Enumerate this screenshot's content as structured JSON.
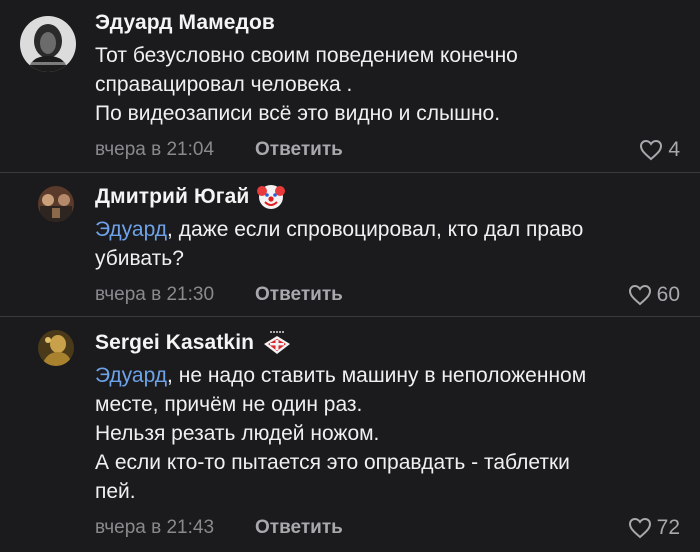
{
  "comments": [
    {
      "author": "Эдуард Мамедов",
      "lines": [
        "Тот безусловно своим поведением конечно",
        "справацировал человека .",
        "По видеозаписи всё это видно и слышно."
      ],
      "mention": "",
      "time": "вчера в 21:04",
      "reply_label": "Ответить",
      "likes": "4",
      "avatar_icon": "portrait-avatar",
      "badge_icon": ""
    },
    {
      "author": "Дмитрий Югай",
      "mention": "Эдуард",
      "lines": [
        ", даже если спровоцировал, кто дал право",
        "убивать?"
      ],
      "time": "вчера в 21:30",
      "reply_label": "Ответить",
      "likes": "60",
      "avatar_icon": "group-photo-avatar",
      "badge_icon": "clown-face-icon"
    },
    {
      "author": "Sergei Kasatkin",
      "mention": "Эдуард",
      "lines": [
        ", не надо ставить машину в неположенном",
        "месте, причём не один раз.",
        "Нельзя резать людей ножом.",
        "А если кто-то пытается это оправдать - таблетки",
        "пей."
      ],
      "time": "вчера в 21:43",
      "reply_label": "Ответить",
      "likes": "72",
      "avatar_icon": "golden-figure-avatar",
      "badge_icon": "spartak-badge-icon"
    }
  ],
  "colors": {
    "background": "#1b1b1d",
    "mention": "#6ea2e8",
    "meta": "#8a8a8e",
    "divider": "#3a3a3e"
  }
}
